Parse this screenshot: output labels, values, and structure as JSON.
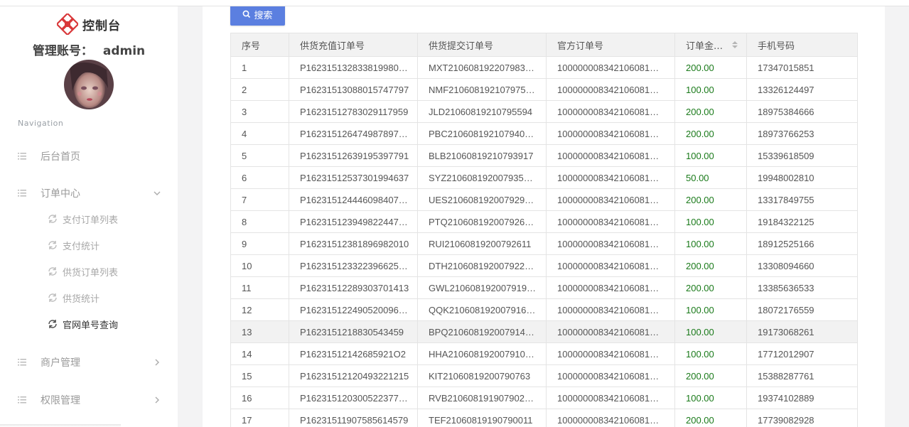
{
  "brand": {
    "title": "控制台"
  },
  "account": {
    "label": "管理账号：",
    "name": "admin"
  },
  "nav": {
    "section_title": "Navigation",
    "items": [
      {
        "label": "后台首页",
        "icon": "menu-lines-icon"
      },
      {
        "label": "订单中心",
        "icon": "menu-lines-icon",
        "expanded": true
      },
      {
        "label": "商户管理",
        "icon": "menu-lines-icon",
        "expanded": false
      },
      {
        "label": "权限管理",
        "icon": "menu-lines-icon",
        "expanded": false
      }
    ],
    "sub_items": [
      {
        "label": "支付订单列表",
        "active": false
      },
      {
        "label": "支付统计",
        "active": false
      },
      {
        "label": "供货订单列表",
        "active": false
      },
      {
        "label": "供货统计",
        "active": false
      },
      {
        "label": "官网单号查询",
        "active": true
      }
    ]
  },
  "toolbar": {
    "search_label": "搜索"
  },
  "table": {
    "headers": [
      "序号",
      "供货充值订单号",
      "供货提交订单号",
      "官方订单号",
      "订单金额…",
      "手机号码"
    ],
    "rows": [
      [
        "1",
        "P162315132833819980…",
        "MXT210608192207983…",
        "100000008342106081…",
        "200.00",
        "17347015851"
      ],
      [
        "2",
        "P16231513088015747797",
        "NMF210608192107975…",
        "100000008342106081…",
        "100.00",
        "13326124497"
      ],
      [
        "3",
        "P16231512783029117959",
        "JLD21060819210795594",
        "100000008342106081…",
        "200.00",
        "18975384666"
      ],
      [
        "4",
        "P162315126474987897…",
        "PBC210608192107940…",
        "100000008342106081…",
        "200.00",
        "18973766253"
      ],
      [
        "5",
        "P16231512639195397791",
        "BLB21060819210793917",
        "100000008342106081…",
        "100.00",
        "15339618509"
      ],
      [
        "6",
        "P16231512537301994637",
        "SYZ210608192007935…",
        "100000008342106081…",
        "50.00",
        "19948002810"
      ],
      [
        "7",
        "P162315124446098407…",
        "UES210608192007929…",
        "100000008342106081…",
        "200.00",
        "13317849755"
      ],
      [
        "8",
        "P162315123949822447…",
        "PTQ210608192007926…",
        "100000008342106081…",
        "100.00",
        "19184322125"
      ],
      [
        "9",
        "P16231512381896982010",
        "RUI21060819200792611",
        "100000008342106081…",
        "100.00",
        "18912525166"
      ],
      [
        "10",
        "P162315123322396625…",
        "DTH210608192007922…",
        "100000008342106081…",
        "200.00",
        "13308094660"
      ],
      [
        "11",
        "P16231512289303701413",
        "GWL210608192007919…",
        "100000008342106081…",
        "200.00",
        "13385636533"
      ],
      [
        "12",
        "P162315122490520096…",
        "QQK210608192007916…",
        "100000008342106081…",
        "100.00",
        "18072176559"
      ],
      [
        "13",
        "P1623151218830543459",
        "BPQ210608192007914…",
        "100000008342106081…",
        "100.00",
        "19173068261"
      ],
      [
        "14",
        "P16231512142685921O2",
        "HHA210608192007910…",
        "100000008342106081…",
        "100.00",
        "17712012907"
      ],
      [
        "15",
        "P16231512120493221215",
        "KIT21060819200790763",
        "100000008342106081…",
        "200.00",
        "15388287761"
      ],
      [
        "16",
        "P162315120300522377…",
        "RVB210608191907902…",
        "100000008342106081…",
        "100.00",
        "19374102889"
      ],
      [
        "17",
        "P16231511907585614579",
        "TEF21060819190790011",
        "100000008342106081…",
        "200.00",
        "17739082928"
      ]
    ],
    "highlighted_row": 13
  },
  "colors": {
    "accent": "#5b7fe0",
    "amount": "#1a7a1a",
    "logo": "#d9383a"
  }
}
